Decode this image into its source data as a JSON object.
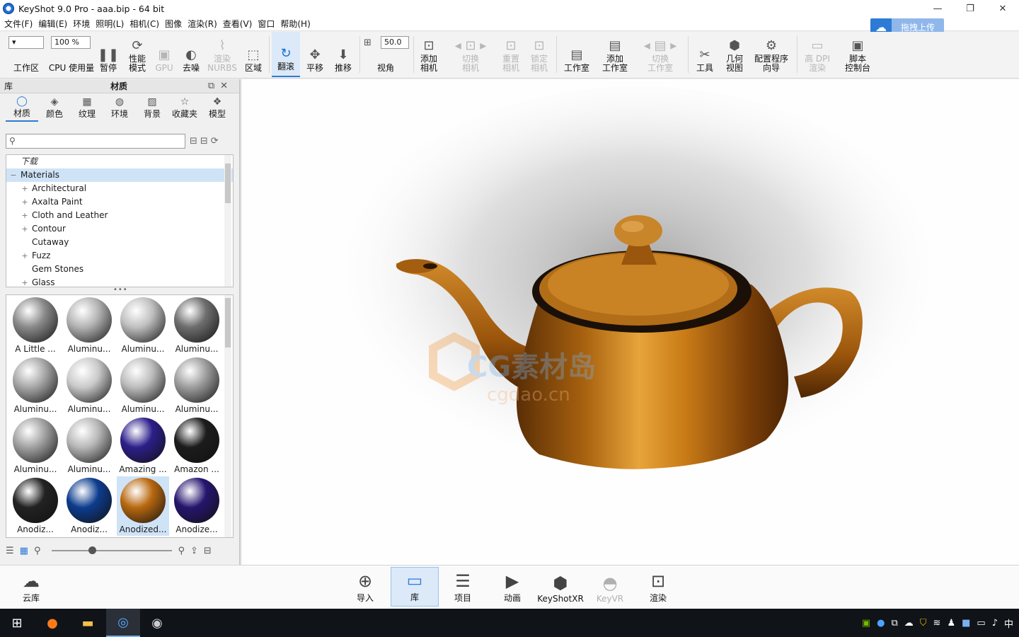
{
  "window": {
    "title": "KeyShot 9.0 Pro  - aaa.bip  - 64 bit",
    "controls": [
      "—",
      "❐",
      "✕"
    ]
  },
  "menu": [
    "文件(F)",
    "编辑(E)",
    "环境",
    "照明(L)",
    "相机(C)",
    "图像",
    "渲染(R)",
    "查看(V)",
    "窗口",
    "帮助(H)"
  ],
  "upload": {
    "label": "拖拽上传",
    "icon": "cloud-upload-icon"
  },
  "toolbar": {
    "workspace_label": "工作区",
    "cpu_value": "100 %",
    "cpu_label": "CPU 使用量",
    "pause_label": "暂停",
    "perf_label": "性能\n模式",
    "gpu_label": "GPU",
    "denoise_label": "去噪",
    "nurbs_label": "渲染\nNURBS",
    "region_label": "区域",
    "tumble_label": "翻滚",
    "pan_label": "平移",
    "dolly_label": "推移",
    "fov_value": "50.0",
    "fov_label": "视角",
    "add_camera_label": "添加\n相机",
    "switch_camera_label": "切换\n相机",
    "reset_camera_label": "重置\n相机",
    "lock_camera_label": "锁定\n相机",
    "studio_label": "工作室",
    "add_studio_label": "添加\n工作室",
    "switch_studio_label": "切换\n工作室",
    "tools_label": "工具",
    "geometry_label": "几何\n视图",
    "wizard_label": "配置程序\n向导",
    "hidpi_label": "高 DPI\n渲染",
    "script_label": "脚本\n控制台"
  },
  "library": {
    "dock_label": "库",
    "title": "材质",
    "tabs": [
      "材质",
      "颜色",
      "纹理",
      "环境",
      "背景",
      "收藏夹",
      "模型"
    ],
    "search_placeholder": "",
    "tree": [
      {
        "label": "下载",
        "type": "dl"
      },
      {
        "label": "Materials",
        "type": "sel"
      },
      {
        "label": "Architectural",
        "type": "plus"
      },
      {
        "label": "Axalta Paint",
        "type": "plus"
      },
      {
        "label": "Cloth and Leather",
        "type": "plus"
      },
      {
        "label": "Contour",
        "type": "plus"
      },
      {
        "label": "Cutaway",
        "type": "leaf"
      },
      {
        "label": "Fuzz",
        "type": "plus"
      },
      {
        "label": "Gem Stones",
        "type": "leaf"
      },
      {
        "label": "Glass",
        "type": "plus"
      }
    ],
    "materials": [
      {
        "label": "A Little ...",
        "color": "#8a8a8a"
      },
      {
        "label": "Aluminu...",
        "color": "#b4b4b4"
      },
      {
        "label": "Aluminu...",
        "color": "#c0c0c0"
      },
      {
        "label": "Aluminu...",
        "color": "#6e6e6e"
      },
      {
        "label": "Aluminu...",
        "color": "#a8a8a8"
      },
      {
        "label": "Aluminu...",
        "color": "#cacaca"
      },
      {
        "label": "Aluminu...",
        "color": "#bdbdbd"
      },
      {
        "label": "Aluminu...",
        "color": "#9e9e9e"
      },
      {
        "label": "Aluminu...",
        "color": "#a2a2a2"
      },
      {
        "label": "Aluminu...",
        "color": "#b8b8b8"
      },
      {
        "label": "Amazing ...",
        "color": "#2c1f8a"
      },
      {
        "label": "Amazon ...",
        "color": "#1c1c1c"
      },
      {
        "label": "Anodiz...",
        "color": "#222222"
      },
      {
        "label": "Anodiz...",
        "color": "#0d3c8e"
      },
      {
        "label": "Anodized...",
        "color": "#b8680f"
      },
      {
        "label": "Anodize...",
        "color": "#26156e"
      }
    ],
    "selected_material_index": 14
  },
  "watermark": {
    "line1": "CG素材岛",
    "line2": "cgdao.cn"
  },
  "ribbon": [
    {
      "label": "云库",
      "icon": "cloud-library-icon"
    },
    {
      "label": "导入",
      "icon": "import-icon"
    },
    {
      "label": "库",
      "icon": "library-book-icon"
    },
    {
      "label": "项目",
      "icon": "project-list-icon"
    },
    {
      "label": "动画",
      "icon": "animation-icon"
    },
    {
      "label": "KeyShotXR",
      "icon": "keyshotxr-icon"
    },
    {
      "label": "KeyVR",
      "icon": "keyvr-icon"
    },
    {
      "label": "渲染",
      "icon": "render-icon"
    }
  ],
  "taskbar": {
    "tray_ime": "中"
  }
}
